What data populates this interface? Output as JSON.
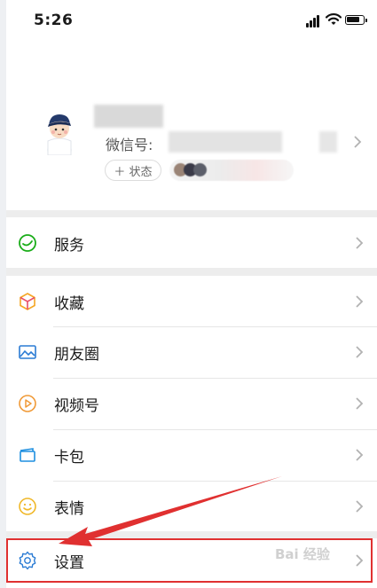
{
  "status_bar": {
    "time": "5:26"
  },
  "profile": {
    "wechat_id_label": "微信号:",
    "status_button_label": "＋ 状态"
  },
  "menu": {
    "services": "服务",
    "favorites": "收藏",
    "moments": "朋友圈",
    "channels": "视频号",
    "cards": "卡包",
    "stickers": "表情",
    "settings": "设置"
  },
  "watermark": "Bai 经验",
  "colors": {
    "services_icon": "#1aad19",
    "favorites_icon": "#f5a623",
    "moments_icon": "#2a7bd4",
    "channels_icon": "#f09a38",
    "cards_icon": "#1e8fe0",
    "stickers_icon": "#f0b82a",
    "settings_icon": "#2a7bd4",
    "highlight": "#e03030"
  }
}
